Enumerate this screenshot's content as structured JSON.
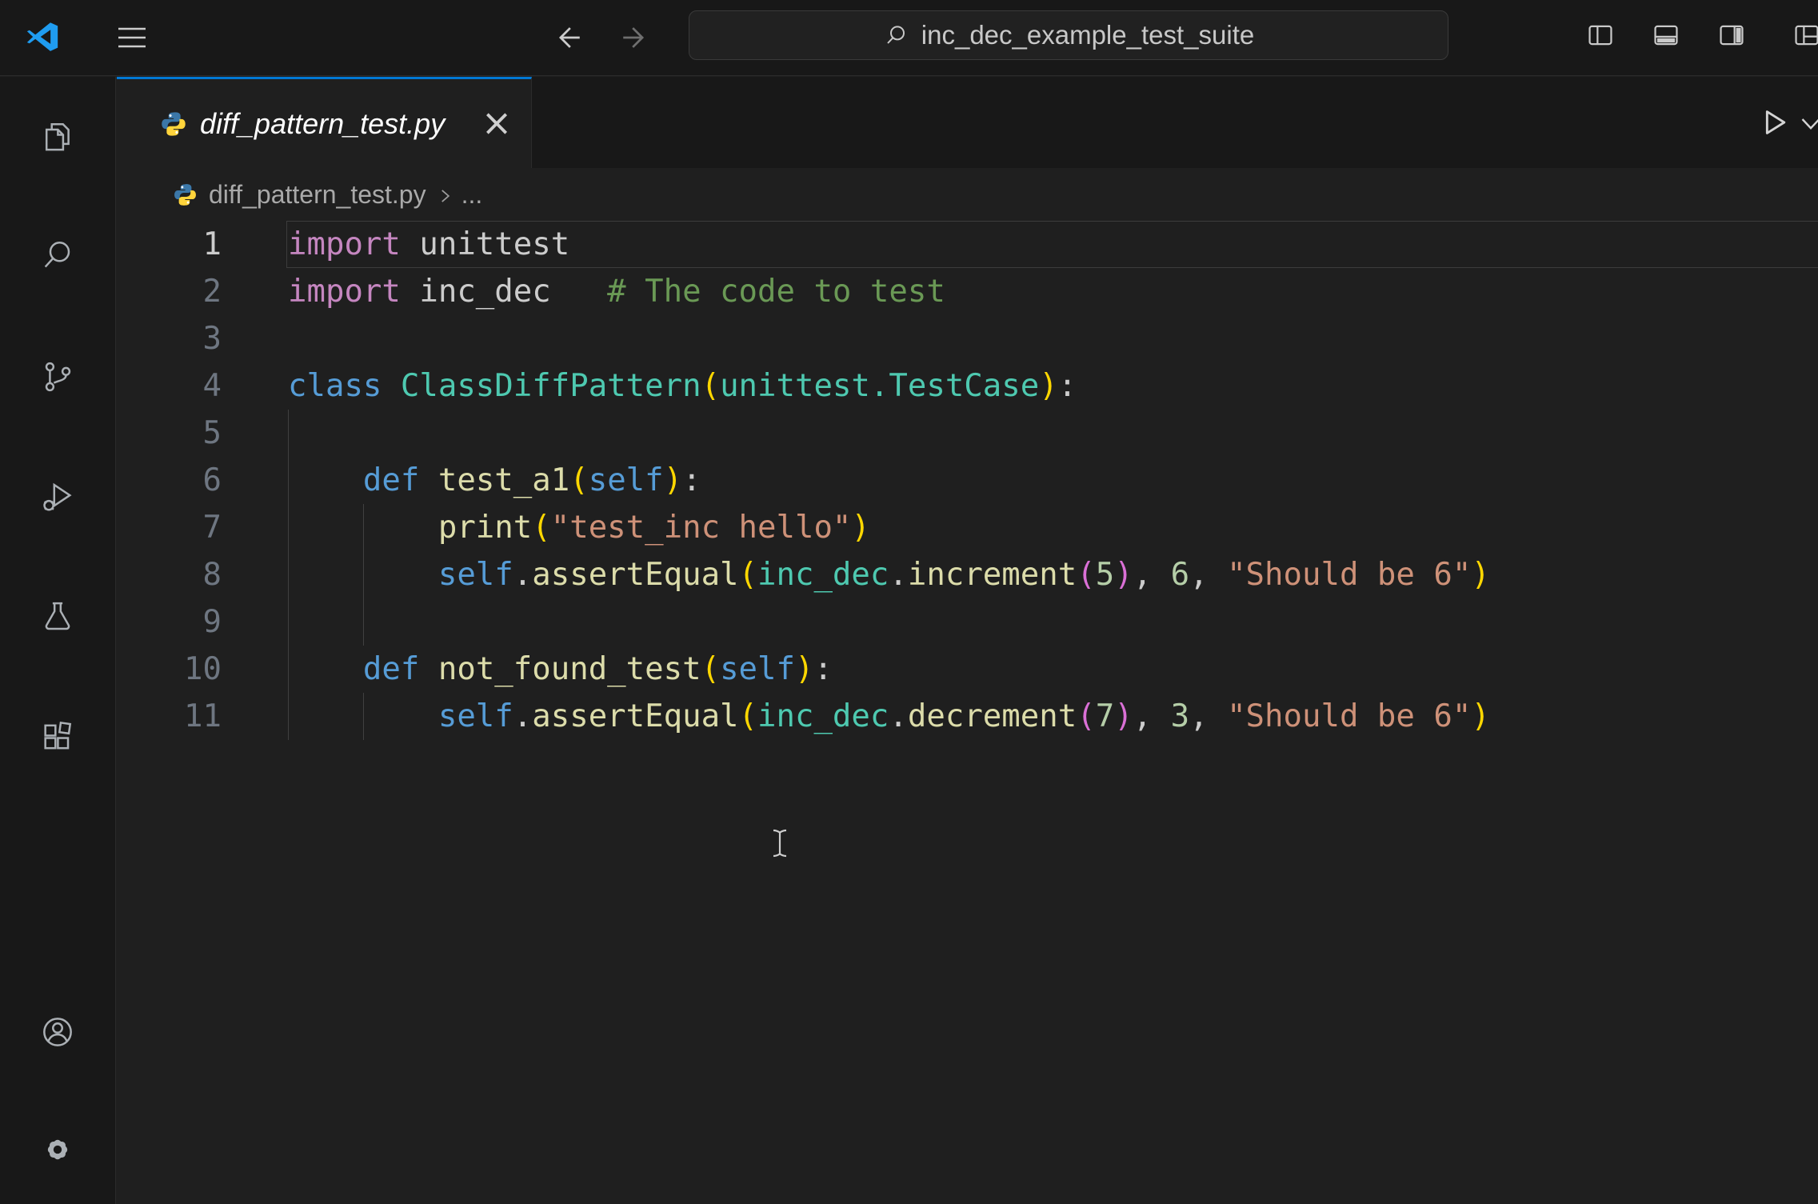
{
  "title_bar": {
    "command_center_label": "inc_dec_example_test_suite"
  },
  "activity_bar": {
    "items": [
      "explorer",
      "search",
      "source-control",
      "run-and-debug",
      "testing",
      "extensions"
    ],
    "bottom_items": [
      "accounts",
      "manage"
    ]
  },
  "editor": {
    "tab": {
      "label": "diff_pattern_test.py",
      "close_glyph": "×"
    },
    "breadcrumb": {
      "file": "diff_pattern_test.py",
      "symbol": "..."
    }
  },
  "colors": {
    "accent_blue": "#0078d4",
    "editor_bg": "#1f1f1f",
    "chrome_bg": "#181818",
    "syntax": {
      "import_keyword": "#C586C0",
      "keyword": "#569CD6",
      "class_type": "#4EC9B0",
      "function": "#DCDCAA",
      "string": "#CE9178",
      "comment": "#6A9955",
      "number": "#B5CEA8",
      "default": "#CCCCCC",
      "bracket_outer": "#FFD700",
      "bracket_inner": "#DA70D6"
    }
  },
  "code": {
    "lines": [
      {
        "num": "1",
        "guides": 0,
        "active": true,
        "tokens": [
          {
            "t": "import",
            "c": "kw"
          },
          {
            "t": " unittest",
            "c": "pln"
          }
        ]
      },
      {
        "num": "2",
        "guides": 0,
        "tokens": [
          {
            "t": "import",
            "c": "kw"
          },
          {
            "t": " inc_dec   ",
            "c": "pln"
          },
          {
            "t": "# The code to test",
            "c": "cmt"
          }
        ]
      },
      {
        "num": "3",
        "guides": 0,
        "tokens": []
      },
      {
        "num": "4",
        "guides": 0,
        "tokens": [
          {
            "t": "class",
            "c": "kwb"
          },
          {
            "t": " ",
            "c": "pln"
          },
          {
            "t": "ClassDiffPattern",
            "c": "typ"
          },
          {
            "t": "(",
            "c": "p1"
          },
          {
            "t": "unittest.TestCase",
            "c": "typ"
          },
          {
            "t": ")",
            "c": "p1"
          },
          {
            "t": ":",
            "c": "pln"
          }
        ]
      },
      {
        "num": "5",
        "guides": 1,
        "tokens": []
      },
      {
        "num": "6",
        "guides": 1,
        "tokens": [
          {
            "t": "    ",
            "c": "pln"
          },
          {
            "t": "def",
            "c": "kwb"
          },
          {
            "t": " ",
            "c": "pln"
          },
          {
            "t": "test_a1",
            "c": "fn"
          },
          {
            "t": "(",
            "c": "p1"
          },
          {
            "t": "self",
            "c": "slf"
          },
          {
            "t": ")",
            "c": "p1"
          },
          {
            "t": ":",
            "c": "pln"
          }
        ]
      },
      {
        "num": "7",
        "guides": 2,
        "tokens": [
          {
            "t": "        ",
            "c": "pln"
          },
          {
            "t": "print",
            "c": "fn"
          },
          {
            "t": "(",
            "c": "p1"
          },
          {
            "t": "\"test_inc hello\"",
            "c": "str"
          },
          {
            "t": ")",
            "c": "p1"
          }
        ]
      },
      {
        "num": "8",
        "guides": 2,
        "tokens": [
          {
            "t": "        ",
            "c": "pln"
          },
          {
            "t": "self",
            "c": "slf"
          },
          {
            "t": ".",
            "c": "pln"
          },
          {
            "t": "assertEqual",
            "c": "fn"
          },
          {
            "t": "(",
            "c": "p1"
          },
          {
            "t": "inc_dec",
            "c": "mod"
          },
          {
            "t": ".",
            "c": "pln"
          },
          {
            "t": "increment",
            "c": "fn"
          },
          {
            "t": "(",
            "c": "p2"
          },
          {
            "t": "5",
            "c": "num"
          },
          {
            "t": ")",
            "c": "p2"
          },
          {
            "t": ", ",
            "c": "pln"
          },
          {
            "t": "6",
            "c": "num"
          },
          {
            "t": ", ",
            "c": "pln"
          },
          {
            "t": "\"Should be 6\"",
            "c": "str"
          },
          {
            "t": ")",
            "c": "p1"
          }
        ]
      },
      {
        "num": "9",
        "guides": 2,
        "tokens": []
      },
      {
        "num": "10",
        "guides": 1,
        "tokens": [
          {
            "t": "    ",
            "c": "pln"
          },
          {
            "t": "def",
            "c": "kwb"
          },
          {
            "t": " ",
            "c": "pln"
          },
          {
            "t": "not_found_test",
            "c": "fn"
          },
          {
            "t": "(",
            "c": "p1"
          },
          {
            "t": "self",
            "c": "slf"
          },
          {
            "t": ")",
            "c": "p1"
          },
          {
            "t": ":",
            "c": "pln"
          }
        ]
      },
      {
        "num": "11",
        "guides": 2,
        "tokens": [
          {
            "t": "        ",
            "c": "pln"
          },
          {
            "t": "self",
            "c": "slf"
          },
          {
            "t": ".",
            "c": "pln"
          },
          {
            "t": "assertEqual",
            "c": "fn"
          },
          {
            "t": "(",
            "c": "p1"
          },
          {
            "t": "inc_dec",
            "c": "mod"
          },
          {
            "t": ".",
            "c": "pln"
          },
          {
            "t": "decrement",
            "c": "fn"
          },
          {
            "t": "(",
            "c": "p2"
          },
          {
            "t": "7",
            "c": "num"
          },
          {
            "t": ")",
            "c": "p2"
          },
          {
            "t": ", ",
            "c": "pln"
          },
          {
            "t": "3",
            "c": "num"
          },
          {
            "t": ", ",
            "c": "pln"
          },
          {
            "t": "\"Should be 6\"",
            "c": "str"
          },
          {
            "t": ")",
            "c": "p1"
          }
        ]
      }
    ]
  }
}
